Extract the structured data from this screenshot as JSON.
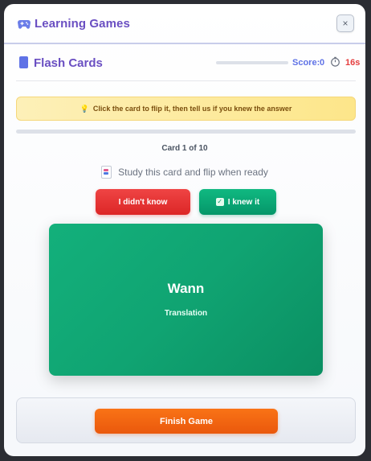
{
  "header": {
    "icon": "gamepad-icon",
    "title": "Learning Games",
    "close_label": "×"
  },
  "game": {
    "icon": "book-icon",
    "title": "Flash Cards",
    "score_label": "Score:",
    "score_value": "0",
    "timer_icon": "stopwatch-icon",
    "timer_value": "16s",
    "score_progress_fraction": 0
  },
  "hint": {
    "icon": "lightbulb-icon",
    "text": "Click the card to flip it, then tell us if you knew the answer"
  },
  "progress": {
    "fraction": 0
  },
  "counter": "Card 1 of 10",
  "study": {
    "icon": "cards-icon",
    "text": "Study this card and flip when ready"
  },
  "buttons": {
    "didnt_know": "I didn't know",
    "knew_it": "I knew it",
    "knew_it_icon": "check-icon"
  },
  "card": {
    "word": "Wann",
    "subtitle": "Translation"
  },
  "footer": {
    "finish_label": "Finish Game"
  },
  "colors": {
    "accent": "#6a4fc2",
    "success": "#10b981",
    "danger": "#ef4444",
    "warning": "#f97316",
    "timer": "#e53e3e"
  }
}
